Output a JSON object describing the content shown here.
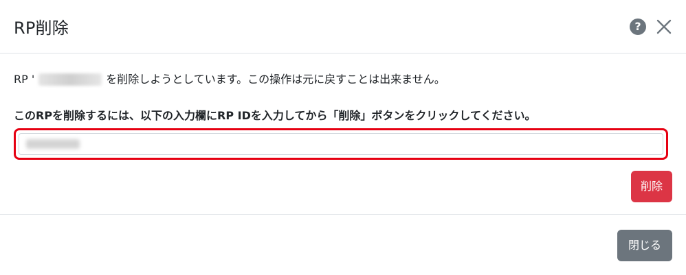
{
  "modal": {
    "title": "RP削除",
    "help_label": "?",
    "message_prefix": "RP '",
    "message_suffix": "を削除しようとしています。この操作は元に戻すことは出来ません。",
    "instruction": "このRPを削除するには、以下の入力欄にRP IDを入力してから「削除」ボタンをクリックしてください。",
    "delete_label": "削除",
    "close_label": "閉じる"
  },
  "colors": {
    "danger": "#dc3545",
    "secondary": "#6c757d",
    "highlight_border": "#e60012"
  }
}
